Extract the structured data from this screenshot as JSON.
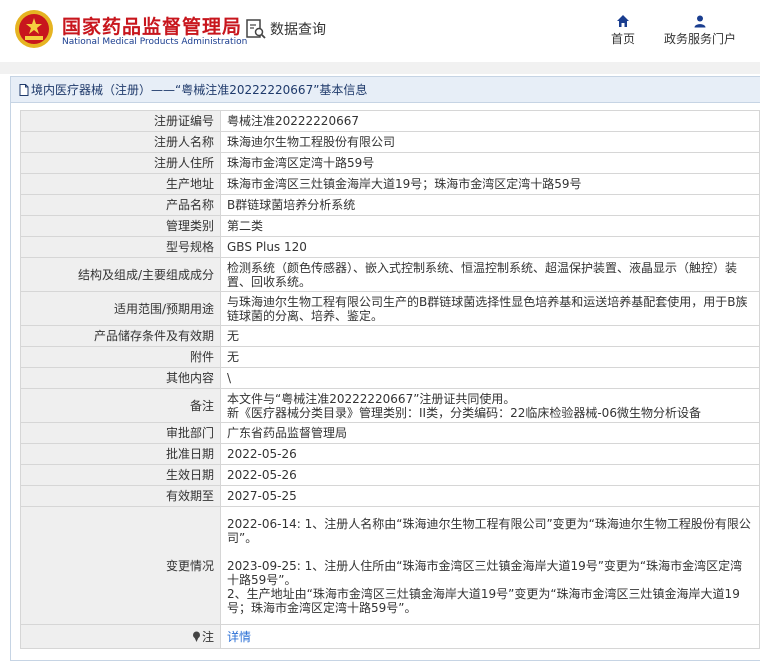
{
  "header": {
    "site_name_cn": "国家药品监督管理局",
    "site_name_en": "National Medical Products Administration",
    "db_query_label": "数据查询",
    "nav_home_label": "首页",
    "nav_portal_label": "政务服务门户"
  },
  "panel": {
    "title": "境内医疗器械（注册）——“粤械注准20222220667”基本信息"
  },
  "rows": [
    {
      "label": "注册证编号",
      "value": "粤械注准20222220667"
    },
    {
      "label": "注册人名称",
      "value": "珠海迪尔生物工程股份有限公司"
    },
    {
      "label": "注册人住所",
      "value": "珠海市金湾区定湾十路59号"
    },
    {
      "label": "生产地址",
      "value": "珠海市金湾区三灶镇金海岸大道19号；珠海市金湾区定湾十路59号"
    },
    {
      "label": "产品名称",
      "value": "B群链球菌培养分析系统"
    },
    {
      "label": "管理类别",
      "value": "第二类"
    },
    {
      "label": "型号规格",
      "value": "GBS Plus 120"
    },
    {
      "label": "结构及组成/主要组成成分",
      "value": "检测系统（颜色传感器）、嵌入式控制系统、恒温控制系统、超温保护装置、液晶显示（触控）装置、回收系统。"
    },
    {
      "label": "适用范围/预期用途",
      "value": "与珠海迪尔生物工程有限公司生产的B群链球菌选择性显色培养基和运送培养基配套使用，用于B族链球菌的分离、培养、鉴定。"
    },
    {
      "label": "产品储存条件及有效期",
      "value": "无"
    },
    {
      "label": "附件",
      "value": "无"
    },
    {
      "label": "其他内容",
      "value": "\\"
    },
    {
      "label": "备注",
      "value_line1": "本文件与“粤械注准20222220667”注册证共同使用。",
      "value_line2": "新《医疗器械分类目录》管理类别：II类，分类编码：22临床检验器械-06微生物分析设备"
    },
    {
      "label": "审批部门",
      "value": "广东省药品监督管理局"
    },
    {
      "label": "批准日期",
      "value": "2022-05-26"
    },
    {
      "label": "生效日期",
      "value": "2022-05-26"
    },
    {
      "label": "有效期至",
      "value": "2027-05-25"
    },
    {
      "label": "变更情况",
      "change1": "2022-06-14: 1、注册人名称由“珠海迪尔生物工程有限公司”变更为“珠海迪尔生物工程股份有限公司”。",
      "change2a": "2023-09-25: 1、注册人住所由“珠海市金湾区三灶镇金海岸大道19号”变更为“珠海市金湾区定湾十路59号”。",
      "change2b": "2、生产地址由“珠海市金湾区三灶镇金海岸大道19号”变更为“珠海市金湾区三灶镇金海岸大道19号；珠海市金湾区定湾十路59号”。"
    },
    {
      "label": "注",
      "value": "详情"
    }
  ],
  "colors": {
    "brand_red": "#c8161d",
    "brand_blue": "#1a3d8f",
    "link_blue": "#2a6fd6"
  }
}
